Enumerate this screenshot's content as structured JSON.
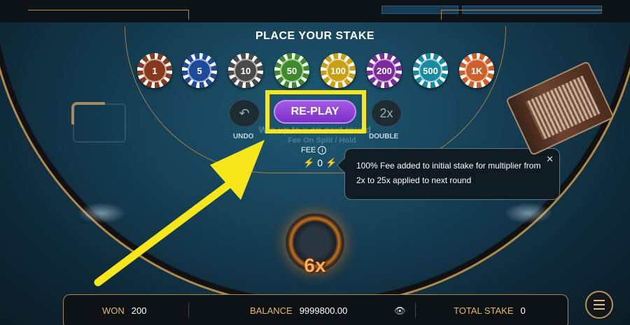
{
  "stake": {
    "title": "PLACE YOUR STAKE",
    "chips": [
      {
        "label": "1",
        "color": "#8a3a1c"
      },
      {
        "label": "5",
        "color": "#1e4a9a"
      },
      {
        "label": "10",
        "color": "#4a4a4a"
      },
      {
        "label": "50",
        "color": "#3f8a2a"
      },
      {
        "label": "100",
        "color": "#c8a016"
      },
      {
        "label": "200",
        "color": "#7a2a9a"
      },
      {
        "label": "500",
        "color": "#1a8aa0"
      },
      {
        "label": "1K",
        "color": "#d0602a"
      }
    ]
  },
  "controls": {
    "undo_label": "UNDO",
    "replay_label": "RE-PLAY",
    "double_label": "DOUBLE",
    "double_icon_text": "2x"
  },
  "table_text": {
    "line1": "Win up to   x  on next round",
    "line2": "Fee On Split / Hold"
  },
  "fee": {
    "label": "FEE",
    "value": "0"
  },
  "tooltip": {
    "text": "100% Fee added to initial stake for multiplier from 2x to 25x applied to next round"
  },
  "multiplier": "6x",
  "bottom": {
    "won_label": "WON",
    "won_value": "200",
    "balance_label": "BALANCE",
    "balance_value": "9999800.00",
    "total_stake_label": "TOTAL STAKE",
    "total_stake_value": "0"
  },
  "colors": {
    "highlight": "#f6e61a",
    "replay": "#8a3ed6",
    "gold": "#b08a4a"
  }
}
